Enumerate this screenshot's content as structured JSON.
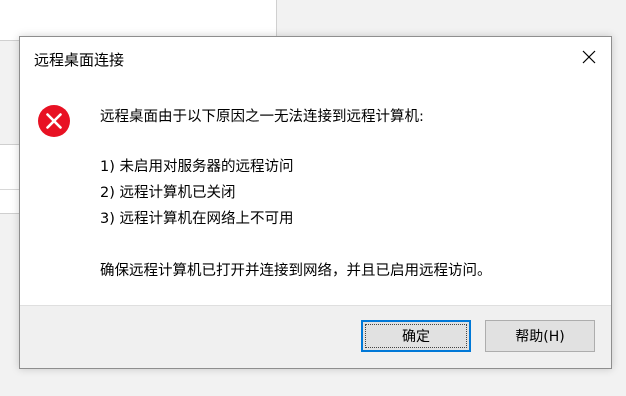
{
  "dialog": {
    "title": "远程桌面连接",
    "close_icon": "close-icon",
    "error_icon": "error-icon",
    "accent_color": "#0078d7",
    "error_color": "#e81123",
    "message": {
      "intro": "远程桌面由于以下原因之一无法连接到远程计算机:",
      "reasons": [
        "1) 未启用对服务器的远程访问",
        "2) 远程计算机已关闭",
        "3) 远程计算机在网络上不可用"
      ],
      "advice": "确保远程计算机已打开并连接到网络，并且已启用远程访问。"
    },
    "buttons": {
      "ok_label": "确定",
      "help_label": "帮助(H)"
    }
  }
}
